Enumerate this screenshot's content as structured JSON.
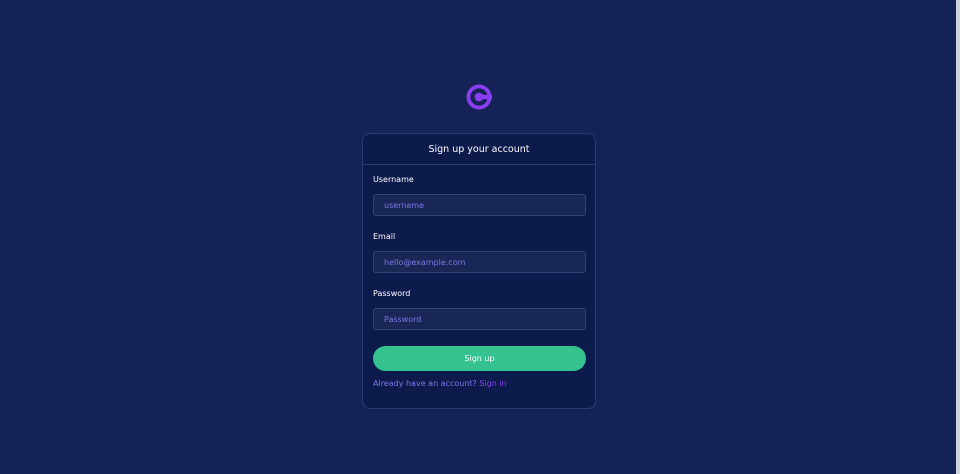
{
  "colors": {
    "background": "#152255",
    "card_background": "#0d1a4c",
    "card_border": "#2d3a6e",
    "accent_purple": "#8b3df2",
    "button_green": "#34c28e",
    "placeholder": "#7b78e6",
    "text": "#ffffff"
  },
  "logo": {
    "icon": "c-logo-icon"
  },
  "card": {
    "title": "Sign up your account"
  },
  "form": {
    "username": {
      "label": "Username",
      "placeholder": "username",
      "value": ""
    },
    "email": {
      "label": "Email",
      "placeholder": "hello@example.com",
      "value": ""
    },
    "password": {
      "label": "Password",
      "placeholder": "Password",
      "value": ""
    },
    "submit_label": "Sign up"
  },
  "footer": {
    "prompt": "Already have an account?",
    "link_label": "Sign in"
  }
}
